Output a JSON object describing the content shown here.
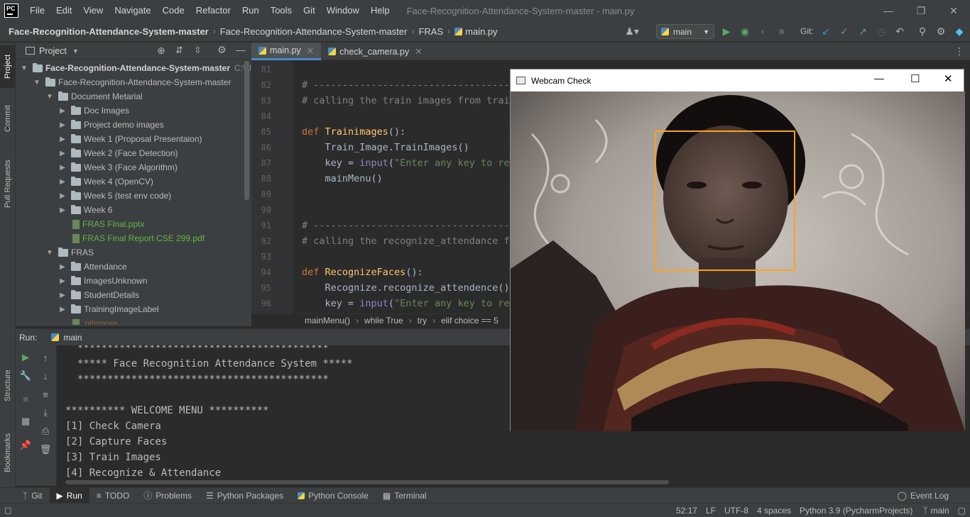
{
  "titlebar": {
    "logo": "PC",
    "menus": [
      "File",
      "Edit",
      "View",
      "Navigate",
      "Code",
      "Refactor",
      "Run",
      "Tools",
      "Git",
      "Window",
      "Help"
    ],
    "window_title": "Face-Recognition-Attendance-System-master - main.py"
  },
  "navbar": {
    "crumbs": [
      "Face-Recognition-Attendance-System-master",
      "Face-Recognition-Attendance-System-master",
      "FRAS",
      "main.py"
    ],
    "run_config": "main",
    "git_label": "Git:"
  },
  "left_stripe": {
    "project": "Project",
    "commit": "Commit",
    "pull_requests": "Pull Requests",
    "structure": "Structure",
    "bookmarks": "Bookmarks"
  },
  "project_panel": {
    "title": "Project",
    "tree": [
      {
        "label": "Face-Recognition-Attendance-System-master",
        "suffix": "C:\\U",
        "depth": 0,
        "type": "folder",
        "open": true
      },
      {
        "label": "Face-Recognition-Attendance-System-master",
        "depth": 1,
        "type": "folder",
        "open": true
      },
      {
        "label": "Document Metarial",
        "depth": 2,
        "type": "folder",
        "open": true
      },
      {
        "label": "Doc Images",
        "depth": 3,
        "type": "folder",
        "open": false
      },
      {
        "label": "Project demo images",
        "depth": 3,
        "type": "folder",
        "open": false
      },
      {
        "label": "Week 1 (Proposal Presentaion)",
        "depth": 3,
        "type": "folder",
        "open": false
      },
      {
        "label": "Week 2 (Face Detection)",
        "depth": 3,
        "type": "folder",
        "open": false
      },
      {
        "label": "Week 3 (Face Algorithm)",
        "depth": 3,
        "type": "folder",
        "open": false
      },
      {
        "label": "Week 4 (OpenCV)",
        "depth": 3,
        "type": "folder",
        "open": false
      },
      {
        "label": "Week 5 (test env code)",
        "depth": 3,
        "type": "folder",
        "open": false
      },
      {
        "label": "Week 6",
        "depth": 3,
        "type": "folder",
        "open": false
      },
      {
        "label": "FRAS Final.pptx",
        "depth": 3,
        "type": "file"
      },
      {
        "label": "FRAS Final Report CSE 299.pdf",
        "depth": 3,
        "type": "file"
      },
      {
        "label": "FRAS",
        "depth": 2,
        "type": "folder",
        "open": true
      },
      {
        "label": "Attendance",
        "depth": 3,
        "type": "folder",
        "open": false
      },
      {
        "label": "ImagesUnknown",
        "depth": 3,
        "type": "folder",
        "open": false
      },
      {
        "label": "StudentDetails",
        "depth": 3,
        "type": "folder",
        "open": false
      },
      {
        "label": "TrainingImageLabel",
        "depth": 3,
        "type": "folder",
        "open": false
      },
      {
        "label": ".gitignore",
        "depth": 3,
        "type": "file"
      }
    ]
  },
  "editor": {
    "tabs": [
      "main.py",
      "check_camera.py"
    ],
    "line_numbers": [
      "81",
      "82",
      "83",
      "84",
      "85",
      "86",
      "87",
      "88",
      "89",
      "90",
      "91",
      "92",
      "93",
      "94",
      "95",
      "96"
    ],
    "code": [
      {
        "text": ""
      },
      {
        "cm": "# ---------------------------------------------"
      },
      {
        "cm": "# calling the train images from train"
      },
      {
        "text": ""
      },
      {
        "kw": "def ",
        "fn": "Trainimages",
        "rest": "():"
      },
      {
        "text": "    Train_Image.TrainImages()"
      },
      {
        "pre": "    key = ",
        "bi": "input",
        "rest": "(",
        "str": "\"Enter any key to ret"
      },
      {
        "text": "    mainMenu()"
      },
      {
        "text": ""
      },
      {
        "text": ""
      },
      {
        "cm": "# ---------------------------------------------"
      },
      {
        "cm": "# calling the recognize_attendance fr"
      },
      {
        "text": ""
      },
      {
        "kw": "def ",
        "fn": "RecognizeFaces",
        "rest": "():"
      },
      {
        "text": "    Recognize.recognize_attendence()"
      },
      {
        "pre": "    key = ",
        "bi": "input",
        "rest": "(",
        "str": "\"Enter any key to ret"
      }
    ],
    "breadcrumb": [
      "mainMenu()",
      "while True",
      "try",
      "elif choice == 5"
    ]
  },
  "run_panel": {
    "label": "Run:",
    "config": "main",
    "console": [
      "  ******************************************",
      "  ***** Face Recognition Attendance System *****",
      "  ******************************************",
      "",
      "********** WELCOME MENU **********",
      "[1] Check Camera",
      "[2] Capture Faces",
      "[3] Train Images",
      "[4] Recognize & Attendance"
    ]
  },
  "bottom_tabs": [
    "Git",
    "Run",
    "TODO",
    "Problems",
    "Python Packages",
    "Python Console",
    "Terminal"
  ],
  "event_log": "Event Log",
  "status_bar": {
    "position": "52:17",
    "line_sep": "LF",
    "encoding": "UTF-8",
    "indent": "4 spaces",
    "interpreter": "Python 3.9 (PycharmProjects)",
    "branch": "main"
  },
  "webcam": {
    "title": "Webcam Check",
    "box_color": "#ffa21a"
  }
}
